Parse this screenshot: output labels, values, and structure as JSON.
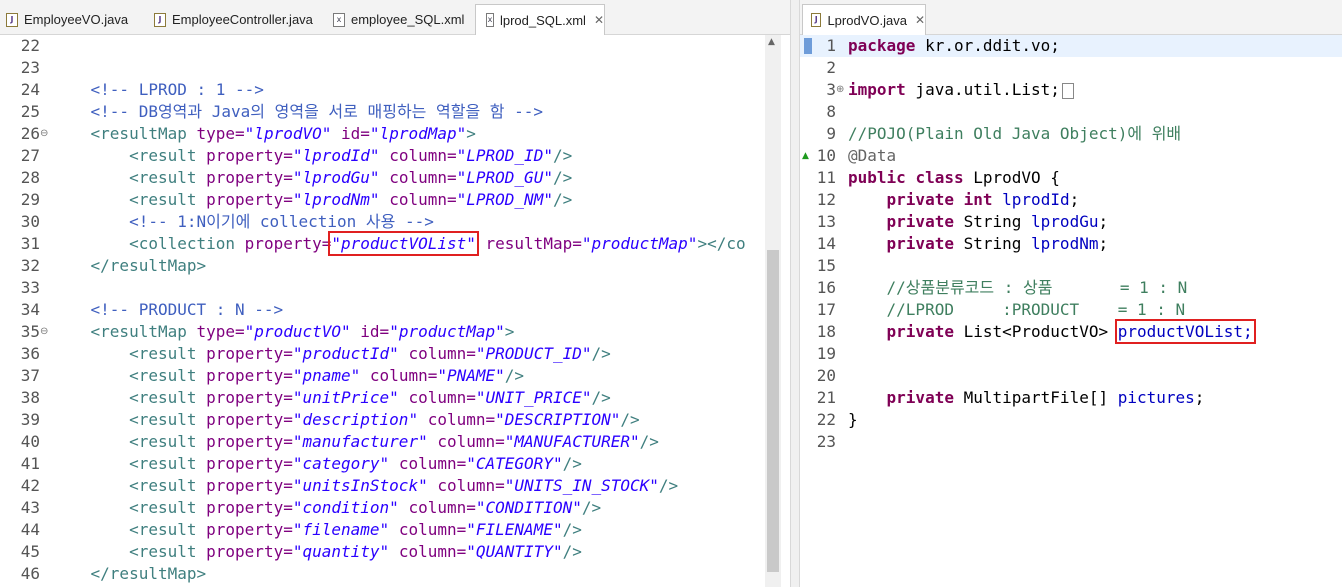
{
  "left_tabs": [
    {
      "name": "EmployeeVO.java",
      "type": "java",
      "active": false
    },
    {
      "name": "EmployeeController.java",
      "type": "java",
      "active": false
    },
    {
      "name": "employee_SQL.xml",
      "type": "xml",
      "active": false
    },
    {
      "name": "lprod_SQL.xml",
      "type": "xml",
      "active": true
    }
  ],
  "right_tabs": [
    {
      "name": "LprodVO.java",
      "type": "java",
      "active": true
    }
  ],
  "left_editor": {
    "lines": [
      {
        "num": "22"
      },
      {
        "num": "23"
      },
      {
        "num": "24",
        "tokens": [
          {
            "t": "    "
          },
          {
            "c": "cm",
            "t": "<!-- LPROD : 1 -->"
          }
        ]
      },
      {
        "num": "25",
        "tokens": [
          {
            "t": "    "
          },
          {
            "c": "cm",
            "t": "<!-- DB영역과 Java의 영역을 서로 매핑하는 역할을 함 -->"
          }
        ]
      },
      {
        "num": "26",
        "fold": true,
        "tokens": [
          {
            "t": "    "
          },
          {
            "c": "tg",
            "t": "<resultMap"
          },
          {
            "t": " "
          },
          {
            "c": "at",
            "t": "type="
          },
          {
            "c": "av",
            "t": "\"lprodVO\""
          },
          {
            "t": " "
          },
          {
            "c": "at",
            "t": "id="
          },
          {
            "c": "av",
            "t": "\"lprodMap\""
          },
          {
            "c": "tg",
            "t": ">"
          }
        ]
      },
      {
        "num": "27",
        "tokens": [
          {
            "t": "        "
          },
          {
            "c": "tg",
            "t": "<result"
          },
          {
            "t": " "
          },
          {
            "c": "at",
            "t": "property="
          },
          {
            "c": "av",
            "t": "\"lprodId\""
          },
          {
            "t": " "
          },
          {
            "c": "at",
            "t": "column="
          },
          {
            "c": "av",
            "t": "\"LPROD_ID\""
          },
          {
            "c": "tg",
            "t": "/>"
          }
        ]
      },
      {
        "num": "28",
        "tokens": [
          {
            "t": "        "
          },
          {
            "c": "tg",
            "t": "<result"
          },
          {
            "t": " "
          },
          {
            "c": "at",
            "t": "property="
          },
          {
            "c": "av",
            "t": "\"lprodGu\""
          },
          {
            "t": " "
          },
          {
            "c": "at",
            "t": "column="
          },
          {
            "c": "av",
            "t": "\"LPROD_GU\""
          },
          {
            "c": "tg",
            "t": "/>"
          }
        ]
      },
      {
        "num": "29",
        "tokens": [
          {
            "t": "        "
          },
          {
            "c": "tg",
            "t": "<result"
          },
          {
            "t": " "
          },
          {
            "c": "at",
            "t": "property="
          },
          {
            "c": "av",
            "t": "\"lprodNm\""
          },
          {
            "t": " "
          },
          {
            "c": "at",
            "t": "column="
          },
          {
            "c": "av",
            "t": "\"LPROD_NM\""
          },
          {
            "c": "tg",
            "t": "/>"
          }
        ]
      },
      {
        "num": "30",
        "tokens": [
          {
            "t": "        "
          },
          {
            "c": "cm",
            "t": "<!-- 1:N이기에 collection 사용 -->"
          }
        ]
      },
      {
        "num": "31",
        "tokens": [
          {
            "t": "        "
          },
          {
            "c": "tg",
            "t": "<collection"
          },
          {
            "t": " "
          },
          {
            "c": "at",
            "t": "property="
          },
          {
            "c": "av hl",
            "t": "\"productVOList\""
          },
          {
            "t": " "
          },
          {
            "c": "at",
            "t": "resultMap="
          },
          {
            "c": "av",
            "t": "\"productMap\""
          },
          {
            "c": "tg",
            "t": "></co"
          }
        ]
      },
      {
        "num": "32",
        "tokens": [
          {
            "t": "    "
          },
          {
            "c": "tg",
            "t": "</resultMap>"
          }
        ]
      },
      {
        "num": "33"
      },
      {
        "num": "34",
        "tokens": [
          {
            "t": "    "
          },
          {
            "c": "cm",
            "t": "<!-- PRODUCT : N -->"
          }
        ]
      },
      {
        "num": "35",
        "fold": true,
        "tokens": [
          {
            "t": "    "
          },
          {
            "c": "tg",
            "t": "<resultMap"
          },
          {
            "t": " "
          },
          {
            "c": "at",
            "t": "type="
          },
          {
            "c": "av",
            "t": "\"productVO\""
          },
          {
            "t": " "
          },
          {
            "c": "at",
            "t": "id="
          },
          {
            "c": "av",
            "t": "\"productMap\""
          },
          {
            "c": "tg",
            "t": ">"
          }
        ]
      },
      {
        "num": "36",
        "tokens": [
          {
            "t": "        "
          },
          {
            "c": "tg",
            "t": "<result"
          },
          {
            "t": " "
          },
          {
            "c": "at",
            "t": "property="
          },
          {
            "c": "av",
            "t": "\"productId\""
          },
          {
            "t": " "
          },
          {
            "c": "at",
            "t": "column="
          },
          {
            "c": "av",
            "t": "\"PRODUCT_ID\""
          },
          {
            "c": "tg",
            "t": "/>"
          }
        ]
      },
      {
        "num": "37",
        "tokens": [
          {
            "t": "        "
          },
          {
            "c": "tg",
            "t": "<result"
          },
          {
            "t": " "
          },
          {
            "c": "at",
            "t": "property="
          },
          {
            "c": "av",
            "t": "\"pname\""
          },
          {
            "t": " "
          },
          {
            "c": "at",
            "t": "column="
          },
          {
            "c": "av",
            "t": "\"PNAME\""
          },
          {
            "c": "tg",
            "t": "/>"
          }
        ]
      },
      {
        "num": "38",
        "tokens": [
          {
            "t": "        "
          },
          {
            "c": "tg",
            "t": "<result"
          },
          {
            "t": " "
          },
          {
            "c": "at",
            "t": "property="
          },
          {
            "c": "av",
            "t": "\"unitPrice\""
          },
          {
            "t": " "
          },
          {
            "c": "at",
            "t": "column="
          },
          {
            "c": "av",
            "t": "\"UNIT_PRICE\""
          },
          {
            "c": "tg",
            "t": "/>"
          }
        ]
      },
      {
        "num": "39",
        "tokens": [
          {
            "t": "        "
          },
          {
            "c": "tg",
            "t": "<result"
          },
          {
            "t": " "
          },
          {
            "c": "at",
            "t": "property="
          },
          {
            "c": "av",
            "t": "\"description\""
          },
          {
            "t": " "
          },
          {
            "c": "at",
            "t": "column="
          },
          {
            "c": "av",
            "t": "\"DESCRIPTION\""
          },
          {
            "c": "tg",
            "t": "/>"
          }
        ]
      },
      {
        "num": "40",
        "tokens": [
          {
            "t": "        "
          },
          {
            "c": "tg",
            "t": "<result"
          },
          {
            "t": " "
          },
          {
            "c": "at",
            "t": "property="
          },
          {
            "c": "av",
            "t": "\"manufacturer\""
          },
          {
            "t": " "
          },
          {
            "c": "at",
            "t": "column="
          },
          {
            "c": "av",
            "t": "\"MANUFACTURER\""
          },
          {
            "c": "tg",
            "t": "/>"
          }
        ]
      },
      {
        "num": "41",
        "tokens": [
          {
            "t": "        "
          },
          {
            "c": "tg",
            "t": "<result"
          },
          {
            "t": " "
          },
          {
            "c": "at",
            "t": "property="
          },
          {
            "c": "av",
            "t": "\"category\""
          },
          {
            "t": " "
          },
          {
            "c": "at",
            "t": "column="
          },
          {
            "c": "av",
            "t": "\"CATEGORY\""
          },
          {
            "c": "tg",
            "t": "/>"
          }
        ]
      },
      {
        "num": "42",
        "tokens": [
          {
            "t": "        "
          },
          {
            "c": "tg",
            "t": "<result"
          },
          {
            "t": " "
          },
          {
            "c": "at",
            "t": "property="
          },
          {
            "c": "av",
            "t": "\"unitsInStock\""
          },
          {
            "t": " "
          },
          {
            "c": "at",
            "t": "column="
          },
          {
            "c": "av",
            "t": "\"UNITS_IN_STOCK\""
          },
          {
            "c": "tg",
            "t": "/>"
          }
        ]
      },
      {
        "num": "43",
        "tokens": [
          {
            "t": "        "
          },
          {
            "c": "tg",
            "t": "<result"
          },
          {
            "t": " "
          },
          {
            "c": "at",
            "t": "property="
          },
          {
            "c": "av",
            "t": "\"condition\""
          },
          {
            "t": " "
          },
          {
            "c": "at",
            "t": "column="
          },
          {
            "c": "av",
            "t": "\"CONDITION\""
          },
          {
            "c": "tg",
            "t": "/>"
          }
        ]
      },
      {
        "num": "44",
        "tokens": [
          {
            "t": "        "
          },
          {
            "c": "tg",
            "t": "<result"
          },
          {
            "t": " "
          },
          {
            "c": "at",
            "t": "property="
          },
          {
            "c": "av",
            "t": "\"filename\""
          },
          {
            "t": " "
          },
          {
            "c": "at",
            "t": "column="
          },
          {
            "c": "av",
            "t": "\"FILENAME\""
          },
          {
            "c": "tg",
            "t": "/>"
          }
        ]
      },
      {
        "num": "45",
        "tokens": [
          {
            "t": "        "
          },
          {
            "c": "tg",
            "t": "<result"
          },
          {
            "t": " "
          },
          {
            "c": "at",
            "t": "property="
          },
          {
            "c": "av",
            "t": "\"quantity\""
          },
          {
            "t": " "
          },
          {
            "c": "at",
            "t": "column="
          },
          {
            "c": "av",
            "t": "\"QUANTITY\""
          },
          {
            "c": "tg",
            "t": "/>"
          }
        ]
      },
      {
        "num": "46",
        "tokens": [
          {
            "t": "    "
          },
          {
            "c": "tg",
            "t": "</resultMap>"
          }
        ]
      }
    ]
  },
  "right_editor": {
    "lines": [
      {
        "num": "1",
        "current": true,
        "tokens": [
          {
            "c": "kw",
            "t": "package"
          },
          {
            "t": " kr.or.ddit.vo;"
          }
        ]
      },
      {
        "num": "2"
      },
      {
        "num": "3",
        "fold": "plus",
        "tokens": [
          {
            "c": "kw",
            "t": "import"
          },
          {
            "t": " java.util.List;"
          },
          {
            "c": "dots",
            "t": ""
          }
        ]
      },
      {
        "num": "8"
      },
      {
        "num": "9",
        "tokens": [
          {
            "c": "jc",
            "t": "//POJO(Plain Old Java Object)에 위배"
          }
        ]
      },
      {
        "num": "10",
        "warn": true,
        "tokens": [
          {
            "c": "an",
            "t": "@Data"
          }
        ]
      },
      {
        "num": "11",
        "tokens": [
          {
            "c": "kw",
            "t": "public"
          },
          {
            "t": " "
          },
          {
            "c": "kw",
            "t": "class"
          },
          {
            "t": " LprodVO {"
          }
        ]
      },
      {
        "num": "12",
        "tokens": [
          {
            "t": "    "
          },
          {
            "c": "kw",
            "t": "private"
          },
          {
            "t": " "
          },
          {
            "c": "kw",
            "t": "int"
          },
          {
            "t": " "
          },
          {
            "c": "fd",
            "t": "lprodId"
          },
          {
            "t": ";"
          }
        ]
      },
      {
        "num": "13",
        "tokens": [
          {
            "t": "    "
          },
          {
            "c": "kw",
            "t": "private"
          },
          {
            "t": " String "
          },
          {
            "c": "fd",
            "t": "lprodGu"
          },
          {
            "t": ";"
          }
        ]
      },
      {
        "num": "14",
        "tokens": [
          {
            "t": "    "
          },
          {
            "c": "kw",
            "t": "private"
          },
          {
            "t": " String "
          },
          {
            "c": "fd",
            "t": "lprodNm"
          },
          {
            "t": ";"
          }
        ]
      },
      {
        "num": "15"
      },
      {
        "num": "16",
        "tokens": [
          {
            "t": "    "
          },
          {
            "c": "jc",
            "t": "//상품분류코드 : 상품       = 1 : N"
          }
        ]
      },
      {
        "num": "17",
        "tokens": [
          {
            "t": "    "
          },
          {
            "c": "jc",
            "t": "//LPROD     :PRODUCT    = 1 : N"
          }
        ]
      },
      {
        "num": "18",
        "tokens": [
          {
            "t": "    "
          },
          {
            "c": "kw",
            "t": "private"
          },
          {
            "t": " List<ProductVO> "
          },
          {
            "c": "fd hl",
            "t": "productVOList;"
          }
        ]
      },
      {
        "num": "19"
      },
      {
        "num": "20"
      },
      {
        "num": "21",
        "tokens": [
          {
            "t": "    "
          },
          {
            "c": "kw",
            "t": "private"
          },
          {
            "t": " MultipartFile[] "
          },
          {
            "c": "fd",
            "t": "pictures"
          },
          {
            "t": ";"
          }
        ]
      },
      {
        "num": "22",
        "tokens": [
          {
            "t": "}"
          }
        ]
      },
      {
        "num": "23"
      }
    ]
  },
  "icons": {
    "java_file": "java-file-icon",
    "xml_file": "xml-file-icon",
    "close": "close-icon",
    "fold": "fold-minus-icon",
    "expand": "fold-plus-icon"
  },
  "colors": {
    "comment": "#3f5fbf",
    "tag": "#3f7f7f",
    "attribute": "#7f007f",
    "attribute_value": "#2a00ff",
    "keyword": "#7f0055",
    "java_comment": "#3f7f5f",
    "field": "#0000c0",
    "highlight_box": "#e02020"
  }
}
